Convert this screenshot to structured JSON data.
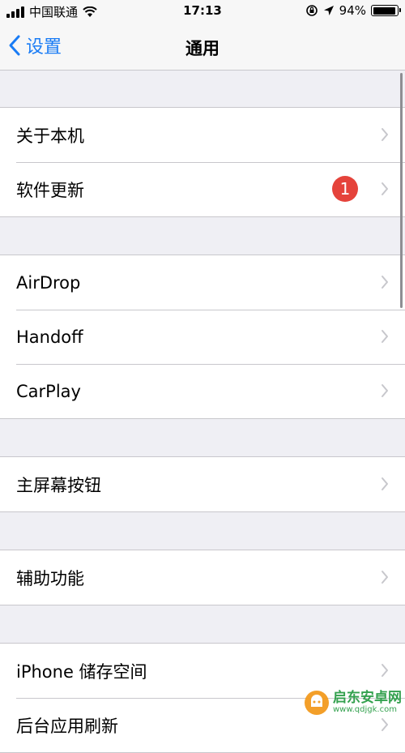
{
  "status_bar": {
    "carrier": "中国联通",
    "time": "17:13",
    "battery_percent": "94%",
    "battery_level": 0.94,
    "icons": [
      "signal-icon",
      "wifi-icon",
      "orientation-lock-icon",
      "location-icon",
      "battery-icon"
    ]
  },
  "nav": {
    "back_label": "设置",
    "title": "通用"
  },
  "groups": [
    {
      "rows": [
        {
          "label": "关于本机"
        },
        {
          "label": "软件更新",
          "badge": "1"
        }
      ]
    },
    {
      "rows": [
        {
          "label": "AirDrop"
        },
        {
          "label": "Handoff"
        },
        {
          "label": "CarPlay"
        }
      ]
    },
    {
      "rows": [
        {
          "label": "主屏幕按钮"
        }
      ]
    },
    {
      "rows": [
        {
          "label": "辅助功能"
        }
      ]
    },
    {
      "rows": [
        {
          "label": "iPhone 储存空间"
        },
        {
          "label": "后台应用刷新"
        }
      ]
    }
  ],
  "colors": {
    "accent": "#1a7cf5",
    "badge": "#e5433b",
    "background": "#efeff4",
    "separator": "#c8c7cc"
  },
  "watermark": {
    "name": "启东安卓网",
    "url": "www.qdjgk.com"
  }
}
